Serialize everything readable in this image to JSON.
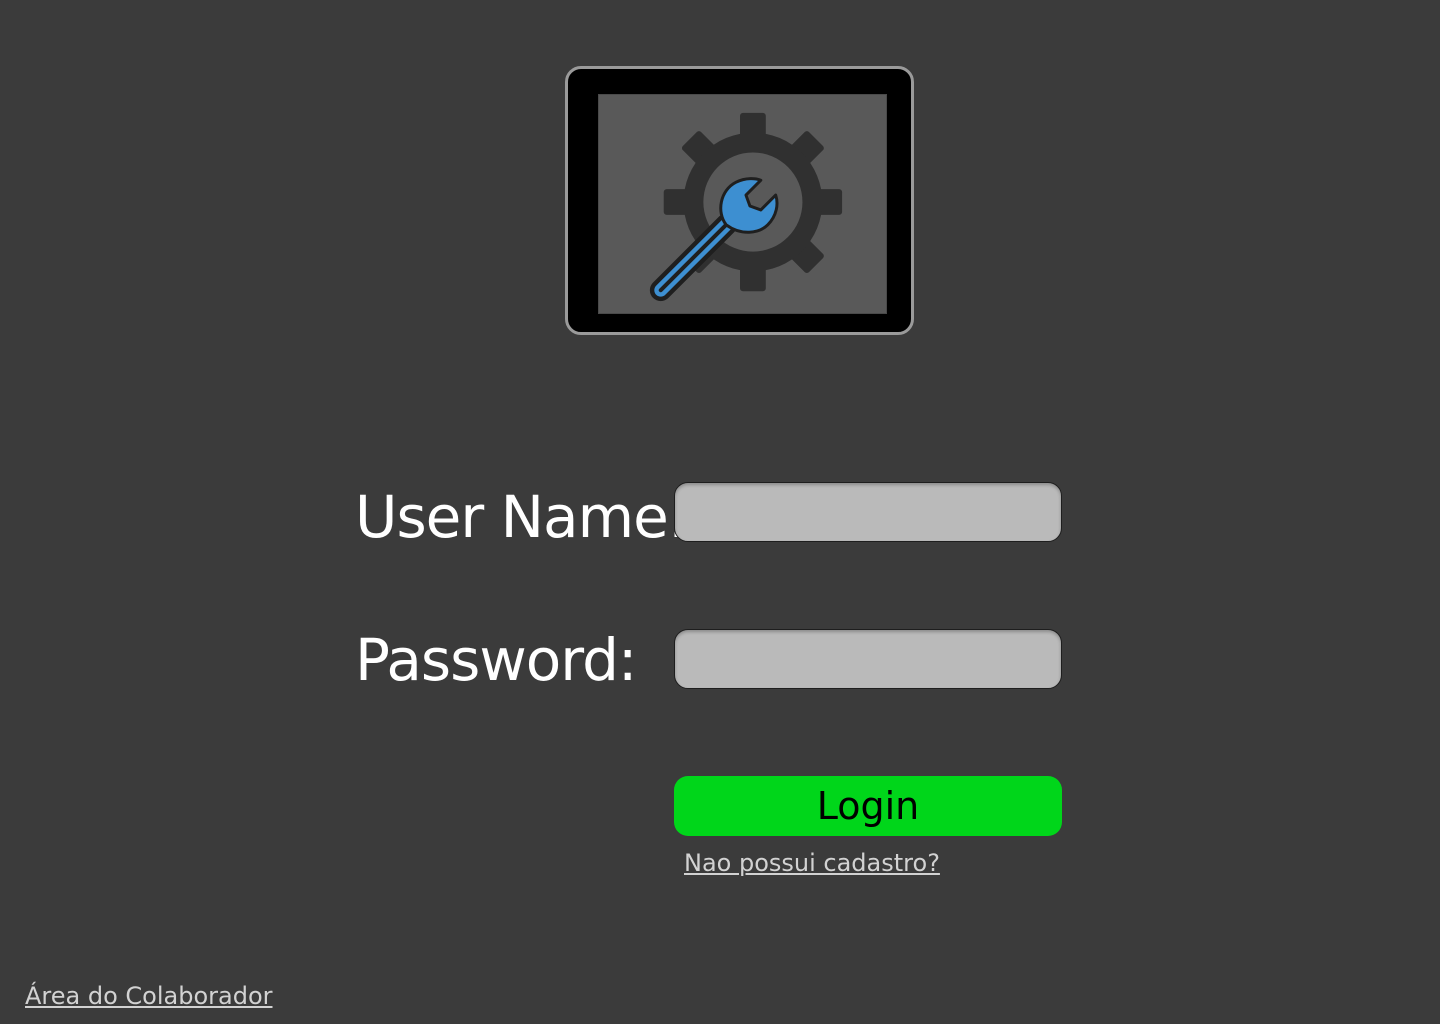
{
  "logo": {
    "icon": "gear-wrench-icon",
    "colors": {
      "frame": "#000000",
      "frame_border": "#9a9a9a",
      "screen": "#595959",
      "gear": "#303030",
      "wrench": "#3d8fd1"
    }
  },
  "form": {
    "username_label": "User Name:",
    "username_value": "",
    "password_label": "Password:",
    "password_value": "",
    "login_label": "Login",
    "register_link": "Nao possui cadastro?"
  },
  "footer": {
    "collaborator_link": "Área do Colaborador"
  },
  "colors": {
    "background": "#3b3b3b",
    "field_bg": "#bababa",
    "login_button": "#00d61a",
    "link": "#d2d2d2"
  }
}
